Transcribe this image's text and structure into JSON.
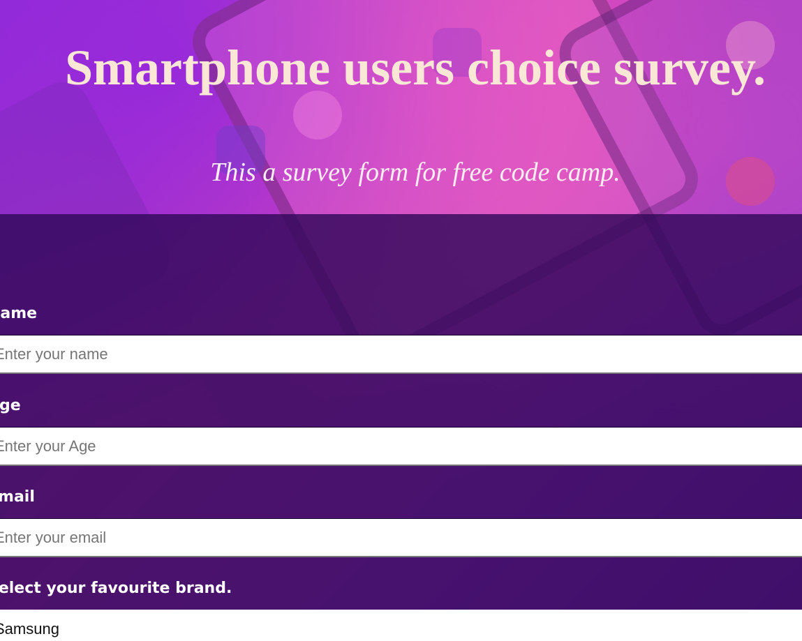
{
  "header": {
    "title": "Smartphone users choice survey.",
    "description": "This a survey form for free code camp."
  },
  "form": {
    "name": {
      "label": "Name",
      "placeholder": "Enter your name"
    },
    "age": {
      "label": "Age",
      "placeholder": "Enter your Age"
    },
    "email": {
      "label": "Email",
      "placeholder": "Enter your email"
    },
    "brand": {
      "label": "Select your favourite brand.",
      "selected": "Samsung"
    }
  },
  "colors": {
    "title": "#fbe7d6",
    "panel": "#32085a",
    "background_accent": "#c43fb8"
  }
}
